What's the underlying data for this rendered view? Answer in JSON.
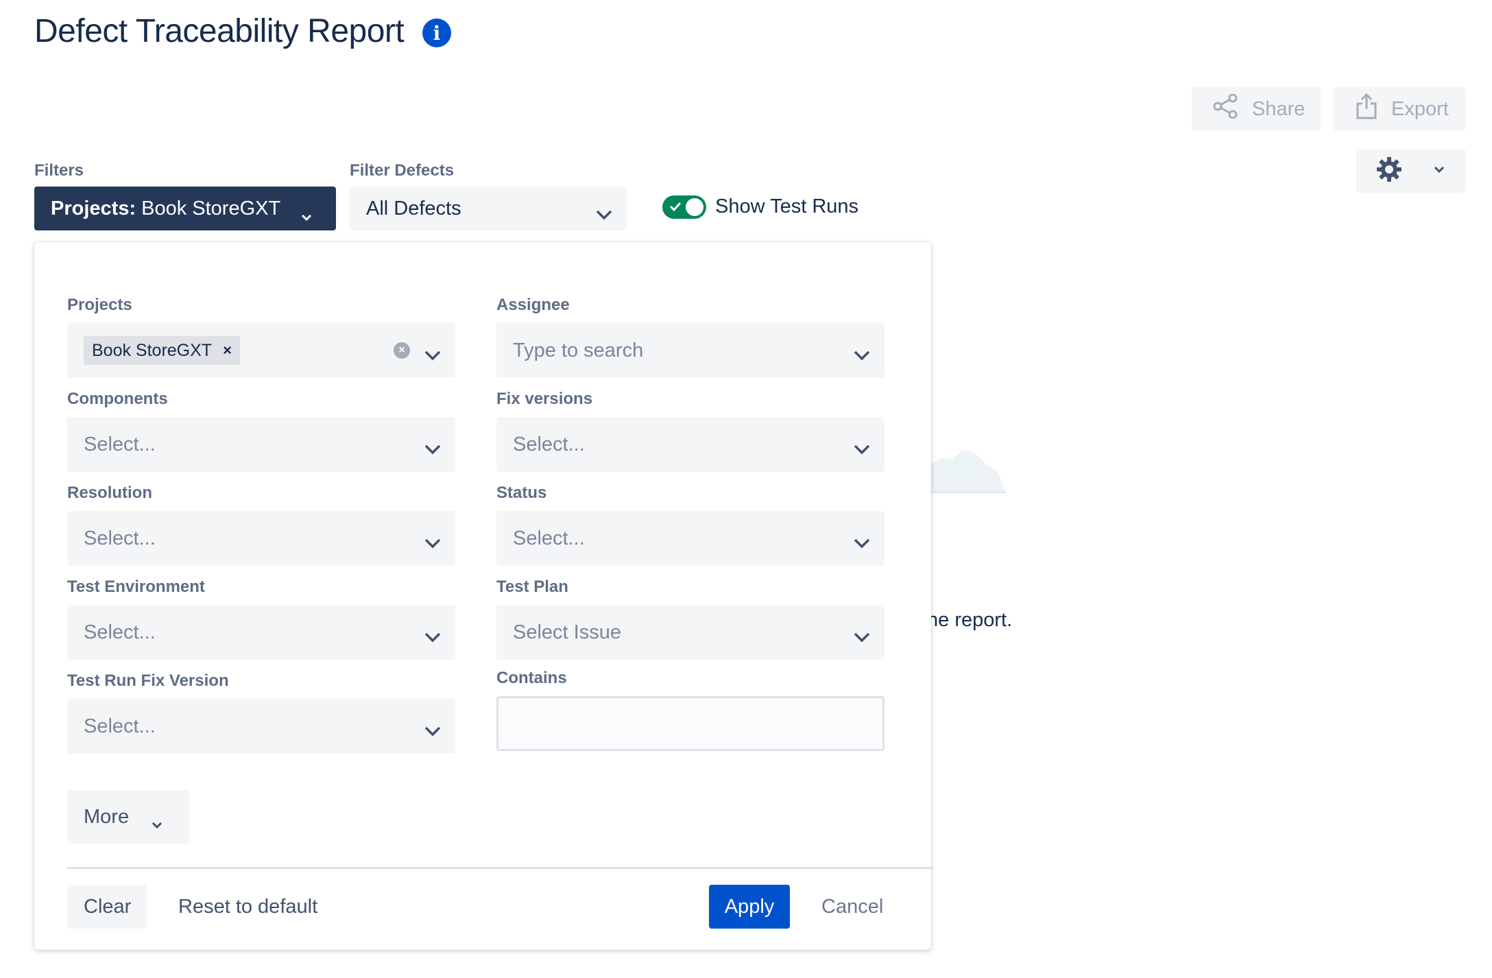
{
  "header": {
    "title": "Defect Traceability Report",
    "info_icon": "info-icon"
  },
  "toolbar": {
    "share_label": "Share",
    "export_label": "Export",
    "settings_icon": "gear-icon"
  },
  "filters_bar": {
    "filters_label": "Filters",
    "projects_prefix": "Projects:",
    "projects_value": "Book StoreGXT",
    "filter_defects_label": "Filter Defects",
    "filter_defects_value": "All Defects",
    "show_test_runs_label": "Show Test Runs",
    "show_test_runs_on": true
  },
  "background": {
    "partial_text": "ne report."
  },
  "filter_panel": {
    "projects": {
      "label": "Projects",
      "tag": "Book StoreGXT"
    },
    "assignee": {
      "label": "Assignee",
      "placeholder": "Type to search"
    },
    "components": {
      "label": "Components",
      "placeholder": "Select..."
    },
    "fix_versions": {
      "label": "Fix versions",
      "placeholder": "Select..."
    },
    "resolution": {
      "label": "Resolution",
      "placeholder": "Select..."
    },
    "status": {
      "label": "Status",
      "placeholder": "Select..."
    },
    "test_environment": {
      "label": "Test Environment",
      "placeholder": "Select..."
    },
    "test_plan": {
      "label": "Test Plan",
      "placeholder": "Select Issue"
    },
    "test_run_fix_version": {
      "label": "Test Run Fix Version",
      "placeholder": "Select..."
    },
    "contains": {
      "label": "Contains",
      "value": ""
    },
    "more_label": "More",
    "clear_label": "Clear",
    "reset_label": "Reset to default",
    "apply_label": "Apply",
    "cancel_label": "Cancel"
  },
  "colors": {
    "primary": "#0052cc",
    "dark_button": "#253858",
    "toggle_on": "#00875a",
    "field_bg": "#f4f5f7"
  }
}
